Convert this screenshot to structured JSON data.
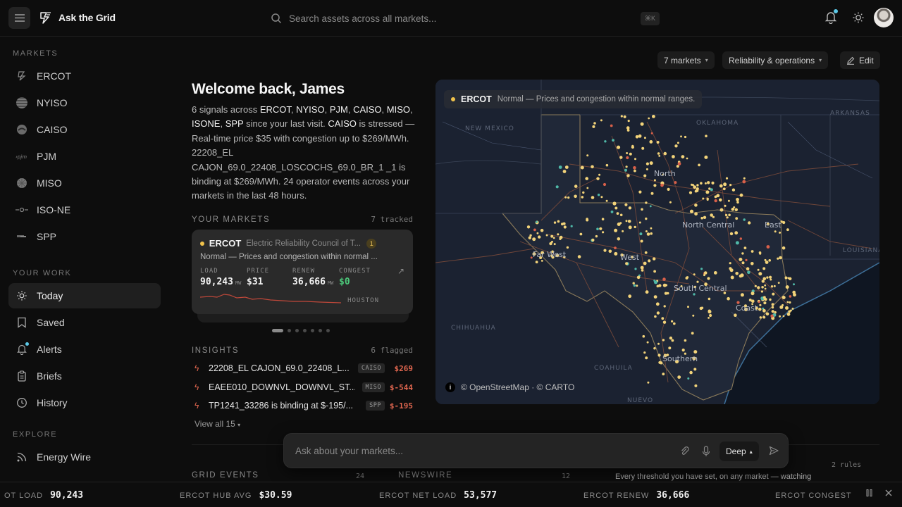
{
  "app": {
    "title": "Ask the Grid"
  },
  "search": {
    "placeholder": "Search assets across all markets...",
    "shortcut": "⌘K"
  },
  "sidebar": {
    "markets_title": "MARKETS",
    "markets": [
      {
        "label": "ERCOT",
        "icon": "ercot-logo-icon"
      },
      {
        "label": "NYISO",
        "icon": "nyiso-logo-icon"
      },
      {
        "label": "CAISO",
        "icon": "caiso-logo-icon"
      },
      {
        "label": "PJM",
        "icon": "pjm-logo-icon"
      },
      {
        "label": "MISO",
        "icon": "miso-logo-icon"
      },
      {
        "label": "ISO-NE",
        "icon": "isone-logo-icon"
      },
      {
        "label": "SPP",
        "icon": "spp-logo-icon"
      }
    ],
    "work_title": "YOUR WORK",
    "work": [
      {
        "label": "Today",
        "icon": "sun-icon",
        "active": true
      },
      {
        "label": "Saved",
        "icon": "bookmark-icon"
      },
      {
        "label": "Alerts",
        "icon": "bell-icon"
      },
      {
        "label": "Briefs",
        "icon": "clipboard-icon"
      },
      {
        "label": "History",
        "icon": "clock-icon"
      }
    ],
    "explore_title": "EXPLORE",
    "explore": [
      {
        "label": "Energy Wire",
        "icon": "rss-icon"
      }
    ]
  },
  "controls": {
    "markets": "7 markets",
    "view": "Reliability & operations",
    "edit": "Edit"
  },
  "welcome": {
    "title": "Welcome back, James",
    "body": [
      {
        "t": "6 signals across "
      },
      {
        "t": "ERCOT",
        "b": true
      },
      {
        "t": ", "
      },
      {
        "t": "NYISO",
        "b": true
      },
      {
        "t": ", "
      },
      {
        "t": "PJM",
        "b": true
      },
      {
        "t": ", "
      },
      {
        "t": "CAISO",
        "b": true
      },
      {
        "t": ", "
      },
      {
        "t": "MISO",
        "b": true
      },
      {
        "t": ", "
      },
      {
        "t": "ISONE",
        "b": true
      },
      {
        "t": ", "
      },
      {
        "t": "SPP",
        "b": true
      },
      {
        "t": " since your last visit. "
      },
      {
        "t": "CAISO",
        "b": true
      },
      {
        "t": " is stressed — Real-time price $35 with congestion up to $269/MWh. 22208_EL CAJON_69.0_22408_LOSCOCHS_69.0_BR_1 _1 is binding at $269/MWh. 24 operator events across your markets in the last 48 hours."
      }
    ]
  },
  "your_markets": {
    "title": "YOUR MARKETS",
    "count": "7 tracked",
    "card": {
      "name": "ERCOT",
      "full_name": "Electric Reliability Council of T...",
      "badge": "1",
      "status": "Normal — Prices and congestion within normal ...",
      "load_label": "LOAD",
      "load": "90,243",
      "load_unit": "MW",
      "price_label": "PRICE",
      "price": "$31",
      "renew_label": "RENEW",
      "renew": "36,666",
      "renew_unit": "MW",
      "congest_label": "CONGEST",
      "congest": "$0",
      "city": "HOUSTON"
    }
  },
  "insights": {
    "title": "INSIGHTS",
    "count": "6 flagged",
    "items": [
      {
        "text": "22208_EL CAJON_69.0_22408_L...",
        "tag": "CAISO",
        "value": "$269"
      },
      {
        "text": "EAEE010_DOWNVL_DOWNVL_ST...",
        "tag": "MISO",
        "value": "$-544"
      },
      {
        "text": "TP1241_33286 is binding at $-195/...",
        "tag": "SPP",
        "value": "$-195"
      }
    ],
    "view_all": "View all 15"
  },
  "map": {
    "banner_market": "ERCOT",
    "banner_text": "Normal — Prices and congestion within normal ranges.",
    "attribution": "© OpenStreetMap · © CARTO",
    "labels": [
      "NEW MEXICO",
      "OKLAHOMA",
      "ARKANSAS",
      "LOUISIANA",
      "CHIHUAHUA",
      "COAHUILA",
      "NUEVO",
      "North",
      "North Central",
      "East",
      "Far West",
      "West",
      "South Central",
      "Coast",
      "Southern"
    ]
  },
  "lower": {
    "grid_events": "GRID EVENTS",
    "grid_events_count": "24",
    "newswire": "NEWSWIRE",
    "newswire_count": "12",
    "rules_count": "2 rules",
    "rules_text": "Every threshold you have set, on any market — watching"
  },
  "ask": {
    "placeholder": "Ask about your markets...",
    "mode": "Deep"
  },
  "ticker": [
    {
      "label": "OT LOAD",
      "value": "90,243"
    },
    {
      "label": "ERCOT HUB AVG",
      "value": "$30.59"
    },
    {
      "label": "ERCOT NET LOAD",
      "value": "53,577"
    },
    {
      "label": "ERCOT RENEW",
      "value": "36,666"
    },
    {
      "label": "ERCOT CONGEST",
      "value": "$("
    }
  ]
}
